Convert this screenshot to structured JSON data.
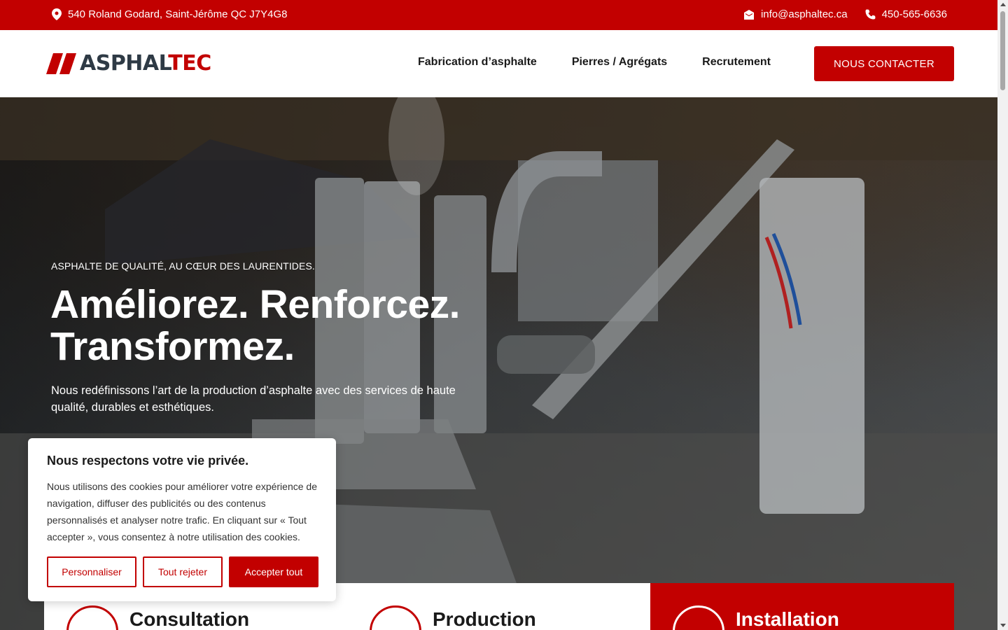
{
  "topbar": {
    "address": "540 Roland Godard, Saint-Jérôme QC J7Y4G8",
    "email": "info@asphaltec.ca",
    "phone": "450-565-6636"
  },
  "header": {
    "logo_part1": "ASPHAL",
    "logo_part2": "T",
    "logo_part3": "EC",
    "nav": [
      {
        "label": "Fabrication d’asphalte"
      },
      {
        "label": "Pierres / Agrégats"
      },
      {
        "label": "Recrutement"
      }
    ],
    "cta_label": "NOUS CONTACTER"
  },
  "hero": {
    "kicker": "ASPHALTE DE QUALITÉ, AU CŒUR DES LAURENTIDES.",
    "headline_line1": "Améliorez. Renforcez.",
    "headline_line2": "Transformez.",
    "subtitle": "Nous redéfinissons l’art de la production d’asphalte avec des services de haute qualité, durables et esthétiques."
  },
  "services": [
    {
      "title": "Consultation",
      "icon": "consultation-icon"
    },
    {
      "title": "Production",
      "icon": "factory-icon"
    },
    {
      "title": "Installation",
      "icon": "truck-icon"
    }
  ],
  "cookie": {
    "title": "Nous respectons votre vie privée.",
    "body": "Nous utilisons des cookies pour améliorer votre expérience de navigation, diffuser des publicités ou des contenus personnalisés et analyser notre trafic. En cliquant sur « Tout accepter », vous consentez à notre utilisation des cookies.",
    "customize": "Personnaliser",
    "reject": "Tout rejeter",
    "accept": "Accepter tout"
  },
  "colors": {
    "brand_red": "#c20000",
    "logo_dark": "#2e3a45"
  }
}
